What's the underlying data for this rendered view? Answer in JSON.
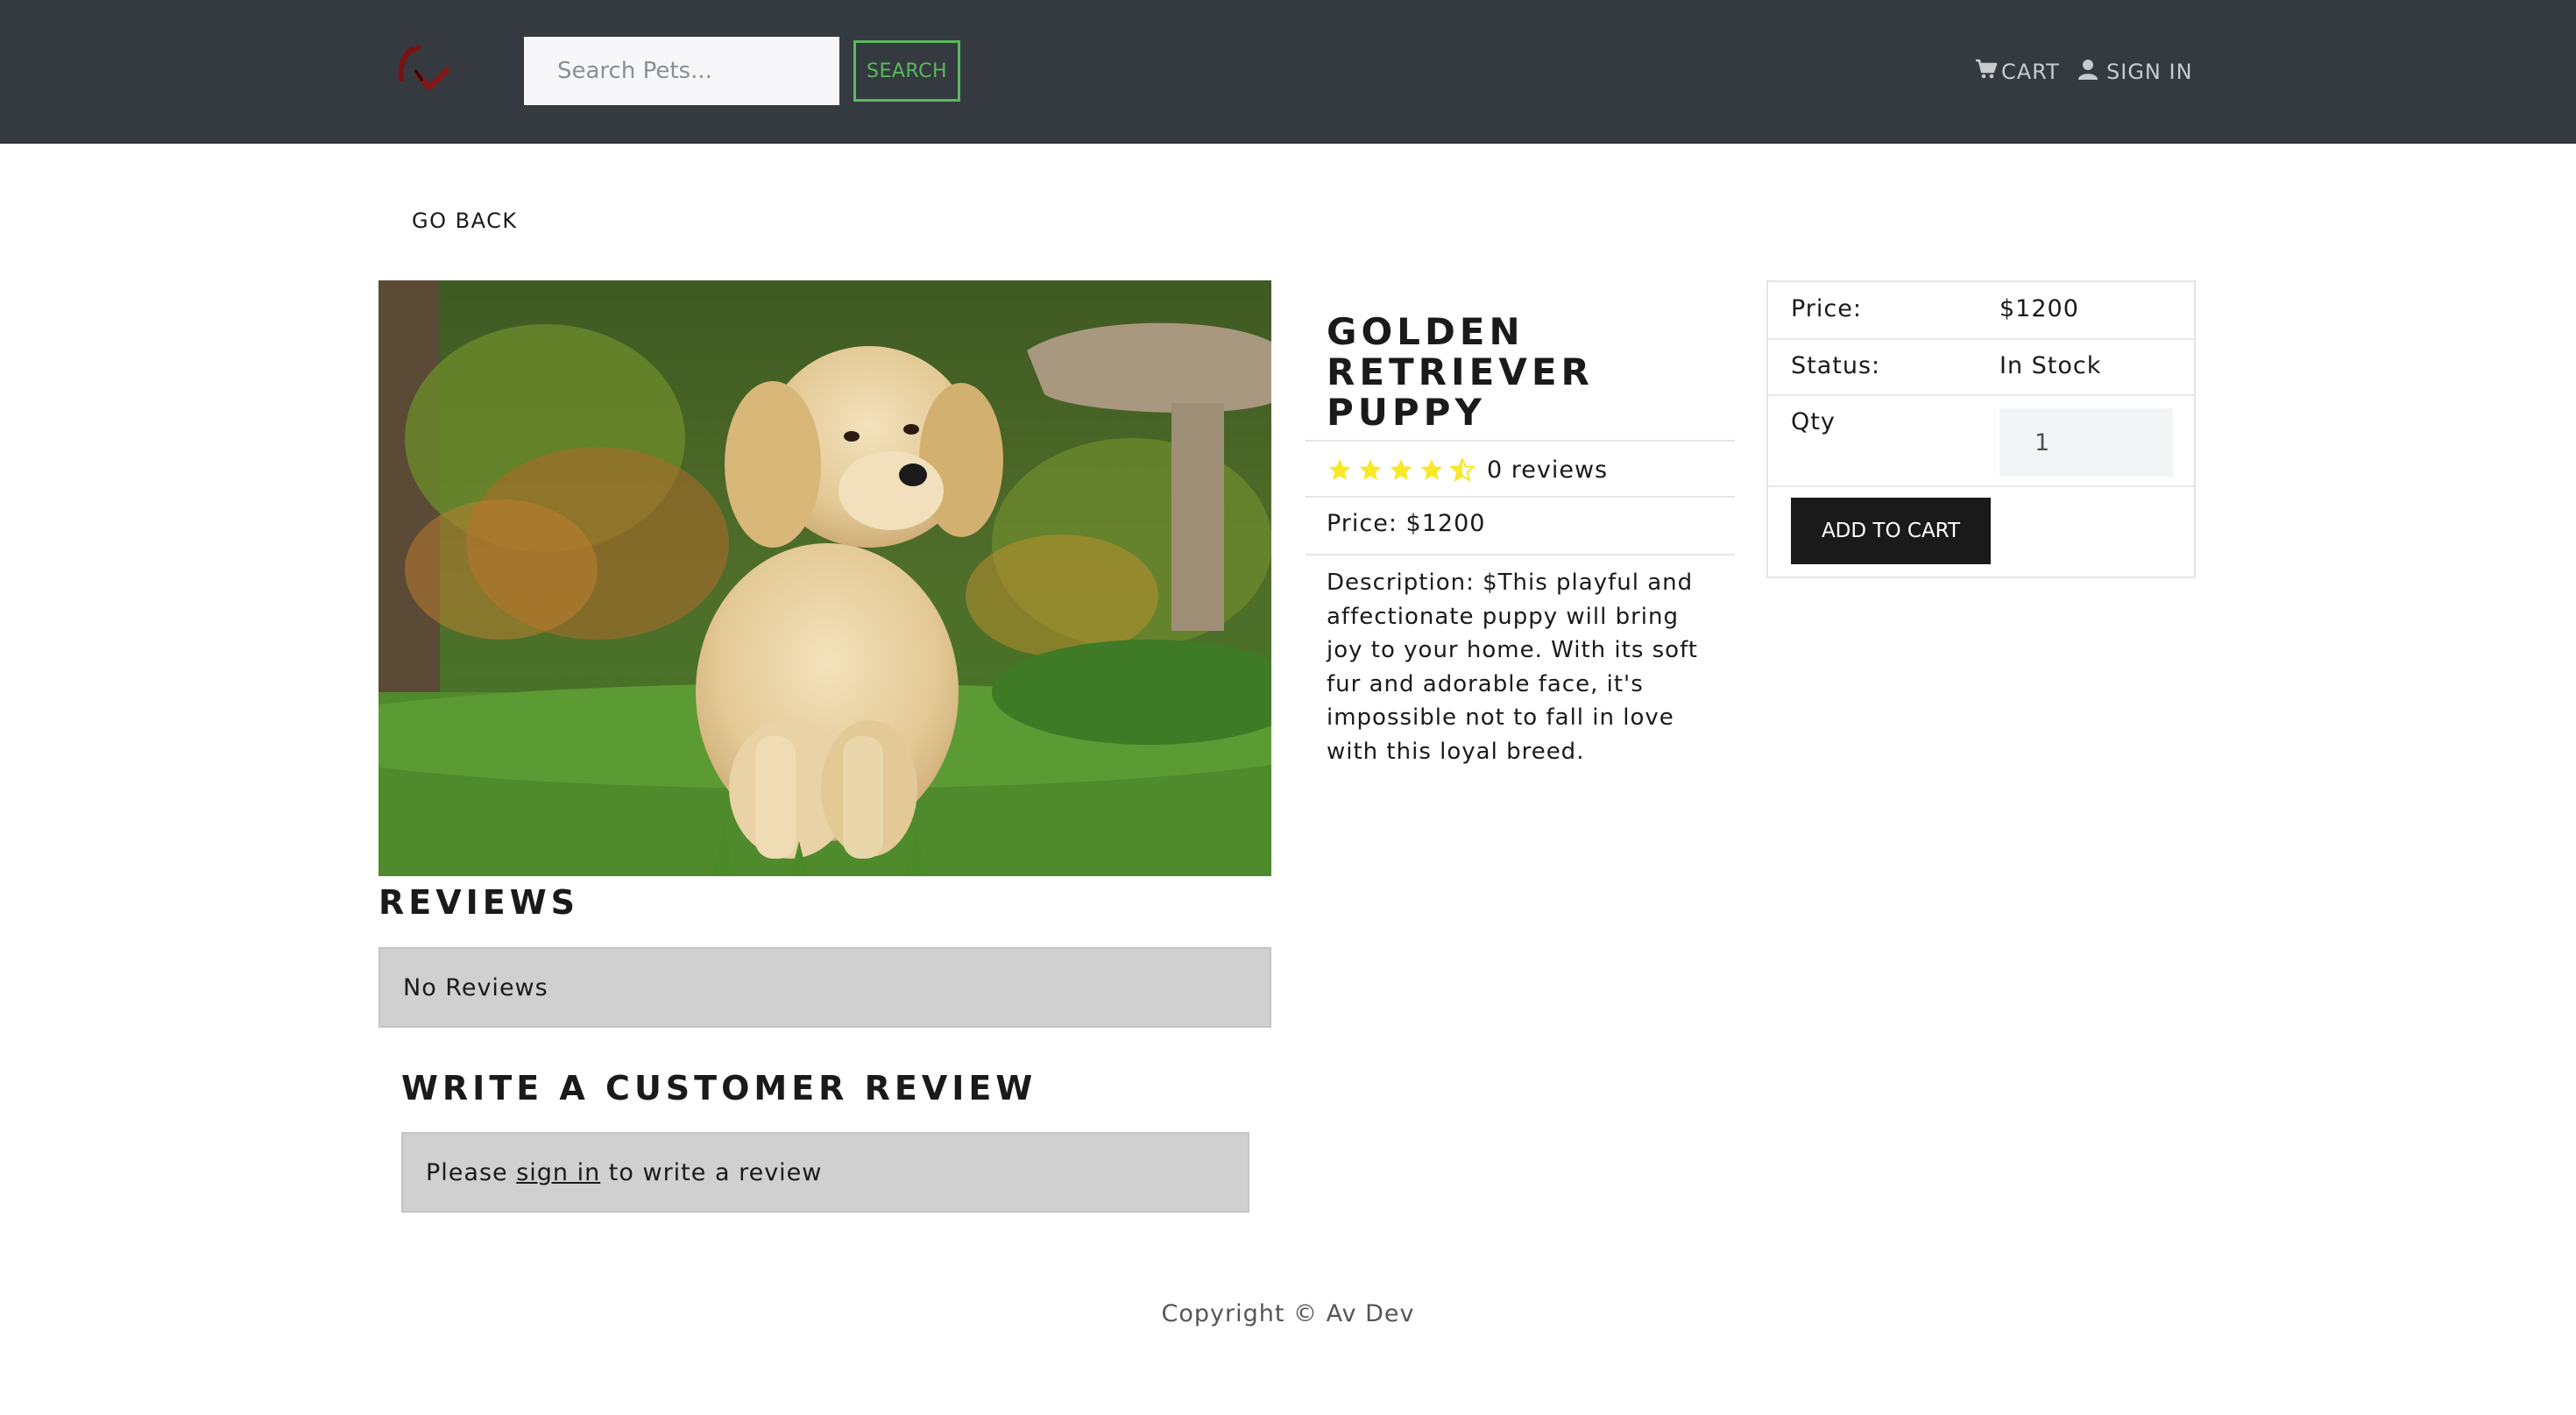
{
  "header": {
    "logo_icon": "brand-logo-icon",
    "search": {
      "placeholder": "Search Pets...",
      "value": ""
    },
    "search_button": "SEARCH",
    "cart_label": "CART",
    "signin_label": "SIGN IN"
  },
  "nav": {
    "go_back": "GO BACK"
  },
  "product": {
    "image_alt": "golden-retriever-puppy-photo",
    "name_line1": "GOLDEN",
    "name_line2": "RETRIEVER PUPPY",
    "rating": 4.5,
    "reviews_text": "0 reviews",
    "price_text": "Price: $1200",
    "description": "Description: $This playful and affectionate puppy will bring joy to your home. With its soft fur and adorable face, it's impossible not to fall in love with this loyal breed."
  },
  "cart_card": {
    "price_label": "Price:",
    "price_value": "$1200",
    "status_label": "Status:",
    "status_value": "In Stock",
    "qty_label": "Qty",
    "qty_value": "1",
    "add_button": "ADD TO CART"
  },
  "reviews": {
    "heading": "REVIEWS",
    "empty_text": "No Reviews",
    "write_heading": "WRITE A CUSTOMER REVIEW",
    "signin_prefix": "Please ",
    "signin_link": "sign in",
    "signin_suffix": " to write a review"
  },
  "footer": {
    "copyright": "Copyright © Av Dev"
  },
  "colors": {
    "navbar_bg": "#343a40",
    "search_accent": "#5cb85c",
    "star": "#f8e825",
    "button_dark": "#1a1a1a",
    "panel_gray": "#d0d0d0"
  }
}
